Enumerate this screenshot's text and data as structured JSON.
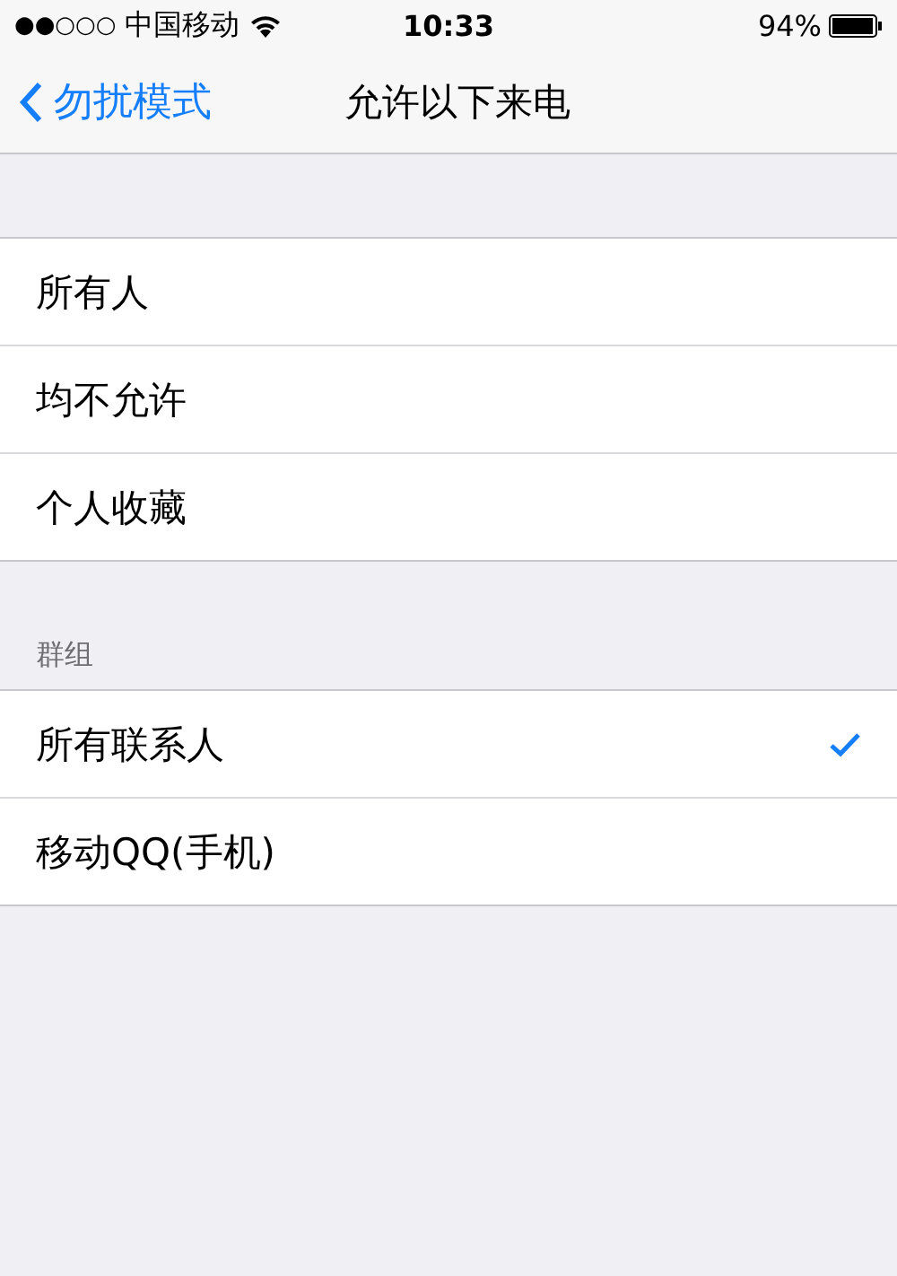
{
  "status_bar": {
    "signal": "●●○○○",
    "carrier": "中国移动",
    "time": "10:33",
    "battery": "94%"
  },
  "nav": {
    "back": "勿扰模式",
    "title": "允许以下来电"
  },
  "sections": [
    {
      "items": [
        {
          "label": "所有人",
          "selected": false
        },
        {
          "label": "均不允许",
          "selected": false
        },
        {
          "label": "个人收藏",
          "selected": false
        }
      ]
    },
    {
      "header": "群组",
      "items": [
        {
          "label": "所有联系人",
          "selected": true
        },
        {
          "label": "移动QQ(手机)",
          "selected": false
        }
      ]
    }
  ]
}
